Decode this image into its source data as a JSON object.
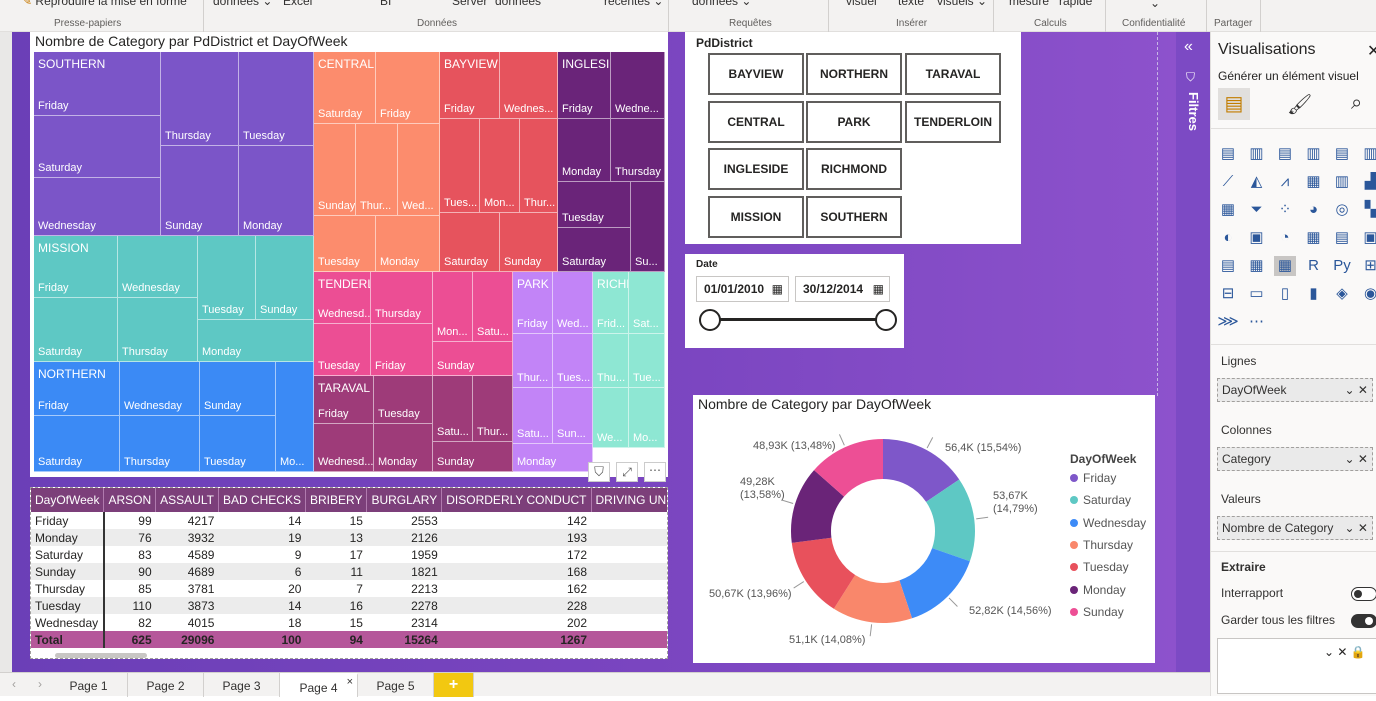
{
  "ribbon": {
    "items": [
      "Reproduire la mise en forme",
      "données ⌄",
      "Excel",
      "BI",
      "Server",
      "données",
      "récentes ⌄",
      "données ⌄",
      "visuel",
      "texte",
      "visuels ⌄",
      "mesure",
      "rapide"
    ],
    "groups": [
      "Presse-papiers",
      "Données",
      "Requêtes",
      "Insérer",
      "Calculs",
      "Confidentialité",
      "Partager"
    ]
  },
  "treemap": {
    "title": "Nombre de Category par PdDistrict et DayOfWeek",
    "districts": [
      "SOUTHERN",
      "CENTRAL",
      "BAYVIEW",
      "INGLESIDE",
      "MISSION",
      "TENDERLOIN",
      "PARK",
      "RICHMOND",
      "NORTHERN",
      "TARAVAL"
    ],
    "southern": [
      "Friday",
      "Thursday",
      "Tuesday",
      "Saturday",
      "Wednesday",
      "Sunday",
      "Monday"
    ],
    "central": [
      "Saturday",
      "Friday",
      "Sunday",
      "Thur...",
      "Wed...",
      "Tuesday",
      "Monday"
    ],
    "bayview": [
      "Friday",
      "Wednes...",
      "Tues...",
      "Mon...",
      "Thur...",
      "Saturday",
      "Sunday"
    ],
    "ingleside": [
      "Friday",
      "Wedne...",
      "Monday",
      "Thursday",
      "Tuesday",
      "Saturday",
      "Su..."
    ],
    "mission": [
      "Friday",
      "Wednesday",
      "Tuesday",
      "Sunday",
      "Saturday",
      "Thursday",
      "Monday"
    ],
    "tenderloin": [
      "Wednesd...",
      "Thursday",
      "Mon...",
      "Satu...",
      "Tuesday",
      "Friday",
      "Sunday"
    ],
    "park": [
      "Friday",
      "Wed...",
      "Thur...",
      "Tues...",
      "Satu...",
      "Sun...",
      "Monday"
    ],
    "richmond": [
      "Frid...",
      "Sat...",
      "Thu...",
      "Tue...",
      "We...",
      "Mo..."
    ],
    "northern": [
      "Friday",
      "Wednesday",
      "Sunday",
      "Saturday",
      "Thursday",
      "Tuesday",
      "Mo..."
    ],
    "taraval": [
      "Friday",
      "Tuesday",
      "Satu...",
      "Thur...",
      "Wednesd...",
      "Monday",
      "Sunday"
    ]
  },
  "slicer_pd": {
    "title": "PdDistrict",
    "buttons": [
      "BAYVIEW",
      "NORTHERN",
      "TARAVAL",
      "CENTRAL",
      "PARK",
      "TENDERLOIN",
      "INGLESIDE",
      "RICHMOND",
      "MISSION",
      "SOUTHERN"
    ]
  },
  "slicer_date": {
    "title": "Date",
    "start": "01/01/2010",
    "end": "30/12/2014"
  },
  "table": {
    "headers": [
      "DayOfWeek",
      "ARSON",
      "ASSAULT",
      "BAD CHECKS",
      "BRIBERY",
      "BURGLARY",
      "DISORDERLY CONDUCT",
      "DRIVING UNDER THE IN"
    ],
    "rows": [
      [
        "Friday",
        "99",
        "4217",
        "14",
        "15",
        "2553",
        "142",
        ""
      ],
      [
        "Monday",
        "76",
        "3932",
        "19",
        "13",
        "2126",
        "193",
        ""
      ],
      [
        "Saturday",
        "83",
        "4589",
        "9",
        "17",
        "1959",
        "172",
        ""
      ],
      [
        "Sunday",
        "90",
        "4689",
        "6",
        "11",
        "1821",
        "168",
        ""
      ],
      [
        "Thursday",
        "85",
        "3781",
        "20",
        "7",
        "2213",
        "162",
        ""
      ],
      [
        "Tuesday",
        "110",
        "3873",
        "14",
        "16",
        "2278",
        "228",
        ""
      ],
      [
        "Wednesday",
        "82",
        "4015",
        "18",
        "15",
        "2314",
        "202",
        ""
      ]
    ],
    "total": [
      "Total",
      "625",
      "29096",
      "100",
      "94",
      "15264",
      "1267",
      ""
    ]
  },
  "chart_data": {
    "type": "pie",
    "title": "Nombre de Category par DayOfWeek",
    "legend_title": "DayOfWeek",
    "legend_position": "right",
    "categories": [
      "Friday",
      "Tuesday",
      "Wednesday",
      "Thursday",
      "Saturday",
      "Monday",
      "Sunday"
    ],
    "values": [
      56.4,
      53.67,
      52.82,
      51.1,
      50.67,
      49.28,
      48.93
    ],
    "labels": [
      "56,4K (15,54%)",
      "53,67K (14,79%)",
      "52,82K (14,56%)",
      "51,1K (14,08%)",
      "50,67K (13,96%)",
      "49,28K (13,58%)",
      "48,93K (13,48%)"
    ],
    "colors": [
      "#7e57c9",
      "#5ec8c4",
      "#3d8bf7",
      "#f9876b",
      "#e8515c",
      "#6a2478",
      "#ed4f95"
    ],
    "legend": [
      "Friday",
      "Saturday",
      "Wednesday",
      "Thursday",
      "Tuesday",
      "Monday",
      "Sunday"
    ],
    "legend_colors": [
      "#7e57c9",
      "#5ec8c4",
      "#3d8bf7",
      "#f9876b",
      "#e8515c",
      "#6a2478",
      "#ed4f95"
    ]
  },
  "vispane": {
    "title": "Visualisations",
    "subtitle": "Générer un élément visuel",
    "lignes": "Lignes",
    "lignes_field": "DayOfWeek",
    "colonnes": "Colonnes",
    "colonnes_field": "Category",
    "valeurs": "Valeurs",
    "valeurs_field": "Nombre de Category",
    "extraire": "Extraire",
    "interrapport": "Interrapport",
    "garder": "Garder tous les filtres"
  },
  "filters_label": "Filtres",
  "tabs": [
    "Page 1",
    "Page 2",
    "Page 3",
    "Page 4",
    "Page 5"
  ],
  "add_tab": "+"
}
